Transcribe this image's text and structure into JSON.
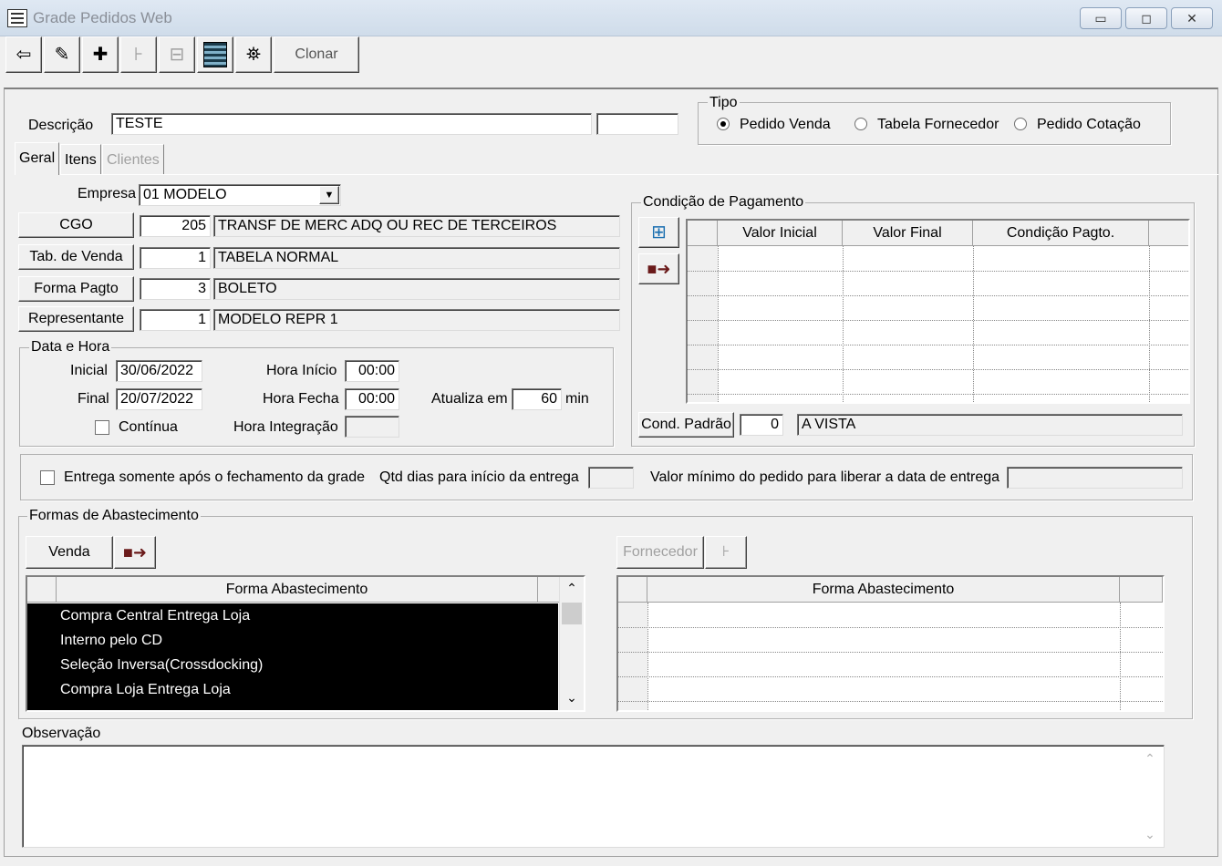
{
  "window": {
    "title": "Grade Pedidos Web",
    "minimize_glyph": "▭",
    "maximize_glyph": "◻",
    "close_glyph": "✕"
  },
  "toolbar": {
    "clone_label": "Clonar",
    "icons": [
      "exit-icon",
      "edit-icon",
      "add-record-icon",
      "tree-add-icon",
      "tree-remove-icon",
      "list-icon",
      "binoculars-icon"
    ]
  },
  "form": {
    "descricao_label": "Descrição",
    "descricao_value": "TESTE",
    "descricao_extra": ""
  },
  "tipo": {
    "title": "Tipo",
    "options": [
      {
        "label": "Pedido Venda",
        "selected": true
      },
      {
        "label": "Tabela Fornecedor",
        "selected": false
      },
      {
        "label": "Pedido Cotação",
        "selected": false
      }
    ]
  },
  "tabs": [
    {
      "label": "Geral",
      "active": true,
      "enabled": true
    },
    {
      "label": "Itens",
      "active": false,
      "enabled": true
    },
    {
      "label": "Clientes",
      "active": false,
      "enabled": false
    }
  ],
  "geral": {
    "empresa_label": "Empresa",
    "empresa_value": "01 MODELO",
    "cgo": {
      "button": "CGO",
      "code": "205",
      "desc": "TRANSF DE MERC ADQ OU REC DE TERCEIROS"
    },
    "tab_venda": {
      "button": "Tab. de Venda",
      "code": "1",
      "desc": "TABELA NORMAL"
    },
    "forma_pagto": {
      "button": "Forma Pagto",
      "code": "3",
      "desc": "BOLETO"
    },
    "representante": {
      "button": "Representante",
      "code": "1",
      "desc": "MODELO REPR 1"
    }
  },
  "data_hora": {
    "title": "Data e Hora",
    "inicial_label": "Inicial",
    "inicial_value": "30/06/2022",
    "final_label": "Final",
    "final_value": "20/07/2022",
    "continua_label": "Contínua",
    "hora_inicio_label": "Hora Início",
    "hora_inicio_value": "00:00",
    "hora_fecha_label": "Hora Fecha",
    "hora_fecha_value": "00:00",
    "hora_integracao_label": "Hora Integração",
    "hora_integracao_value": "",
    "atualiza_label": "Atualiza em",
    "atualiza_value": "60",
    "min_label": "min"
  },
  "cond_pagamento": {
    "title": "Condição de Pagamento",
    "columns": [
      "Valor Inicial",
      "Valor Final",
      "Condição Pagto."
    ],
    "padrao_button": "Cond. Padrão",
    "padrao_code": "0",
    "padrao_desc": "A VISTA"
  },
  "entrega": {
    "checkbox_label": "Entrega somente após o fechamento da grade",
    "qtd_dias_label": "Qtd dias para início da entrega",
    "qtd_dias_value": "",
    "valor_min_label": "Valor mínimo do pedido para liberar a data de entrega",
    "valor_min_value": ""
  },
  "abastecimento": {
    "title": "Formas de Abastecimento",
    "venda_button": "Venda",
    "fornecedor_button": "Fornecedor",
    "left_header": "Forma Abastecimento",
    "right_header": "Forma Abastecimento",
    "rows": [
      "Compra Central Entrega Loja",
      "Interno pelo CD",
      "Seleção Inversa(Crossdocking)",
      "Compra Loja Entrega Loja"
    ],
    "scroll_up": "⌃",
    "scroll_down": "⌄"
  },
  "observacao": {
    "label": "Observação",
    "value": ""
  }
}
